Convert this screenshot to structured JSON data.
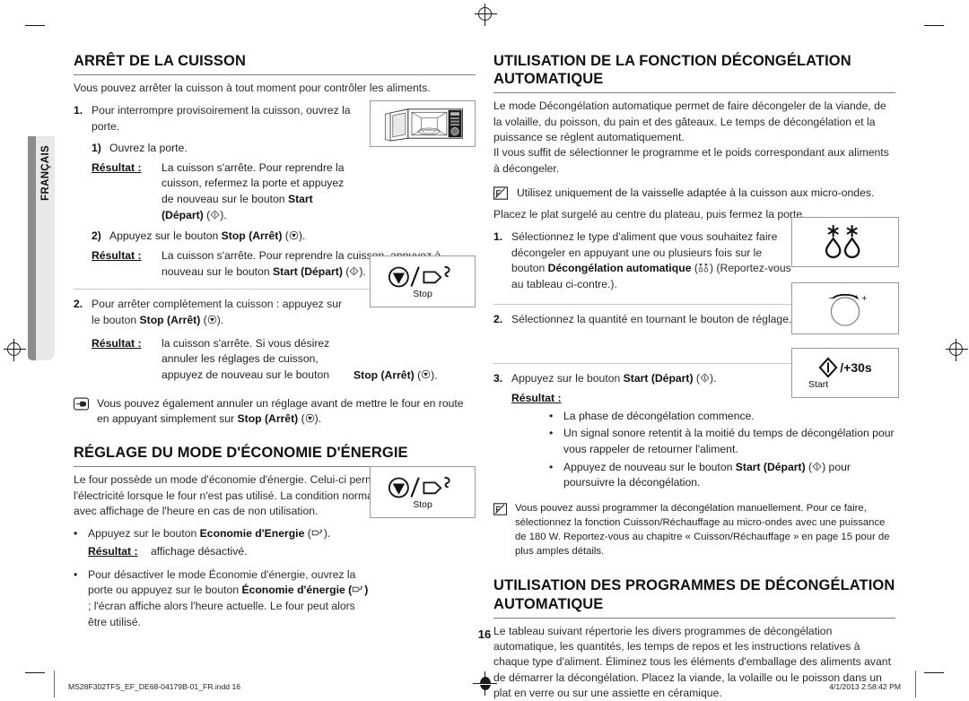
{
  "language_tab": {
    "label": "FRANÇAIS"
  },
  "page_number": "16",
  "footer": {
    "file": "MS28F302TFS_EF_DE68-04179B-01_FR.indd   16",
    "timestamp": "4/1/2013   2:58:42 PM"
  },
  "left_column": {
    "section1": {
      "heading": "ARRÊT DE LA CUISSON",
      "intro": "Vous pouvez arrêter la cuisson à tout moment pour contrôler les aliments.",
      "step1": {
        "num": "1.",
        "text": "Pour interrompre provisoirement la cuisson, ouvrez la porte.",
        "sub1_num": "1)",
        "sub1_text": "Ouvrez la porte.",
        "result1_label": "Résultat :",
        "result1_text_a": "La cuisson s'arrête. Pour reprendre la cuisson, refermez la porte et appuyez de nouveau sur le bouton ",
        "result1_bold": "Start (Départ)",
        "result1_text_b": " (",
        "result1_icon": "start-icon",
        "result1_text_c": ").",
        "sub2_num": "2)",
        "sub2_text_a": "Appuyez sur le bouton ",
        "sub2_bold": "Stop (Arrêt)",
        "sub2_text_b": " (",
        "sub2_icon": "stop-icon",
        "sub2_text_c": ").",
        "result2_label": "Résultat :",
        "result2_text_a": "La cuisson s'arrête. Pour reprendre la cuisson, appuyez à nouveau sur le bouton ",
        "result2_bold": "Start (Départ)",
        "result2_text_c": ")."
      },
      "step2": {
        "num": "2.",
        "text_a": "Pour arrêter complètement la cuisson : appuyez sur le bouton ",
        "bold": "Stop (Arrêt)",
        "text_b": " (",
        "text_c": ").",
        "result_label": "Résultat :",
        "result_text_a": "la cuisson s'arrête. Si vous désirez annuler les réglages de cuisson, appuyez de nouveau sur le bouton ",
        "result_bold": "Stop (Arrêt)",
        "result_text_c": ")."
      },
      "note": {
        "text_a": "Vous pouvez également annuler un réglage avant de mettre le four en route en appuyant simplement sur ",
        "bold": "Stop (Arrêt)",
        "text_c": ")."
      },
      "figure_oven": {
        "name": "open-microwave-oven-illustration"
      },
      "figure_stop": {
        "caption": "Stop",
        "name": "stop-energy-saving-button"
      }
    },
    "section2": {
      "heading": "RÉGLAGE DU MODE D'ÉCONOMIE D'ÉNERGIE",
      "intro": "Le four possède un mode d'économie d'énergie. Celui-ci permet d'économiser l'électricité lorsque le four n'est pas utilisé. La condition normale est le mode veille avec affichage de l'heure en cas de non utilisation.",
      "bullet1": {
        "text_a": "Appuyez sur le bouton ",
        "bold": "Economie d'Energie",
        "text_b": " (",
        "text_c": ").",
        "result_label": "Résultat :",
        "result_text": "affichage désactivé."
      },
      "bullet2": {
        "text_a": "Pour désactiver le mode Économie d'énergie, ouvrez la porte ou appuyez sur le bouton ",
        "bold": "Économie d'énergie (",
        "bold_close": ")",
        "text_c": " ; l'écran affiche alors l'heure actuelle. Le four peut alors être utilisé."
      },
      "figure_stop": {
        "caption": "Stop",
        "name": "stop-energy-saving-button"
      }
    }
  },
  "right_column": {
    "section1": {
      "heading": "UTILISATION DE LA FONCTION DÉCONGÉLATION AUTOMATIQUE",
      "intro1": "Le mode Décongélation automatique permet de faire décongeler de la viande, de la volaille, du poisson, du pain et des gâteaux. Le temps de décongélation et la puissance se règlent automatiquement.",
      "intro2": "Il vous suffit de sélectionner le programme et le poids correspondant aux aliments à décongeler.",
      "note1": "Utilisez uniquement de la vaisselle adaptée à la cuisson aux micro-ondes.",
      "intro3": "Placez le plat surgelé au centre du plateau, puis fermez la porte.",
      "step1": {
        "num": "1.",
        "text_a": "Sélectionnez le type d'aliment que vous souhaitez faire décongeler en appuyant une ou plusieurs fois sur le bouton ",
        "bold": "Décongélation automatique",
        "text_b": " (",
        "text_c": ") (Reportez-vous au tableau ci-contre.)."
      },
      "step2": {
        "num": "2.",
        "text": "Sélectionnez la quantité en tournant le bouton de réglage."
      },
      "step3": {
        "num": "3.",
        "text_a": "Appuyez sur le bouton ",
        "bold": "Start (Départ)",
        "text_b": " (",
        "text_c": ").",
        "result_label": "Résultat :",
        "bullets": [
          {
            "text": "La phase de décongélation commence."
          },
          {
            "text": "Un signal sonore retentit à la moitié du temps de décongélation pour vous rappeler de retourner l'aliment."
          },
          {
            "text_a": "Appuyez de nouveau sur le bouton ",
            "bold": "Start (Départ)",
            "text_b": " (",
            "text_c": ") pour poursuivre la décongélation."
          }
        ]
      },
      "note2": "Vous pouvez aussi programmer la décongélation manuellement. Pour ce faire, sélectionnez la fonction Cuisson/Réchauffage au micro-ondes avec une puissance de 180 W. Reportez-vous au chapitre « Cuisson/Réchauffage » en page 15 pour de plus amples détails.",
      "figure_defrost": {
        "name": "auto-defrost-snowflake-droplet-icon"
      },
      "figure_dial": {
        "minus": "−",
        "plus": "+",
        "name": "rotary-knob-illustration"
      },
      "figure_start": {
        "label": "/+30s",
        "caption": "Start",
        "name": "start-plus-30s-button"
      }
    },
    "section2": {
      "heading": "UTILISATION DES PROGRAMMES DE DÉCONGÉLATION AUTOMATIQUE",
      "intro": "Le tableau suivant répertorie les divers programmes de décongélation automatique, les quantités, les temps de repos et les instructions relatives à chaque type d'aliment. Éliminez tous les éléments d'emballage des aliments avant de démarrer la décongélation. Placez la viande, la volaille ou le poisson dans un plat en verre ou sur une assiette en céramique."
    }
  }
}
